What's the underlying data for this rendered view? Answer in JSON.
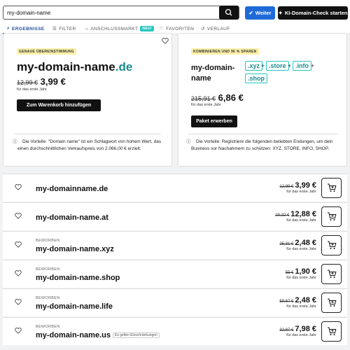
{
  "search": {
    "value": "my-domain-name"
  },
  "buttons": {
    "weiter": "Weiter",
    "ki": "KI-Domain-Check starten"
  },
  "tabs": [
    {
      "label": "ERGEBNISSE"
    },
    {
      "label": "FILTER"
    },
    {
      "label": "ANSCHLUSSMARKT"
    },
    {
      "label": "FAVORITEN"
    },
    {
      "label": "VERLAUF"
    }
  ],
  "tab_badge": "NEU!",
  "card_exact": {
    "badge": "GENAUE ÜBEREINSTIMMUNG",
    "domain_name": "my-domain-name",
    "domain_tld": ".de",
    "old_price": "12,99 €",
    "price": "3,99 €",
    "period": "für das erste Jahr",
    "cta": "Zum Warenkorb hinzufügen",
    "info": "Die Vorteile: \"Domain name\" ist ein Schlagwort von hohem Wert, das einen durchschnittlichen Verkaufspreis von 2.066,00 € erzielt."
  },
  "card_bundle": {
    "badge": "KOMBINIEREN UND 96 % SPAREN",
    "name_line1": "my-domain-",
    "name_line2": "name",
    "tlds": [
      ".xyz",
      ".store",
      ".info",
      ".shop"
    ],
    "old_price": "215,91 €",
    "price": "6,86 €",
    "period": "für das erste Jahr",
    "cta": "Paket erwerben",
    "info": "Die Vorteile: Registriere die folgenden beliebten Endungen, um dein Business vor Nachahmern zu schützen: XYZ, STORE, INFO, SHOP."
  },
  "results": [
    {
      "label": "",
      "domain": "my-domainname.de",
      "old": "12,99 €",
      "price": "3,99 €",
      "period": "für das erste Jahr",
      "hint": ""
    },
    {
      "label": "",
      "domain": "my-domain-name.at",
      "old": "20,22 €",
      "price": "12,88 €",
      "period": "für das erste Jahr",
      "hint": ""
    },
    {
      "label": "BEWORBEN",
      "domain": "my-domain-name.xyz",
      "old": "25,31 €",
      "price": "2,48 €",
      "period": "für das erste Jahr",
      "hint": ""
    },
    {
      "label": "BEWORBEN",
      "domain": "my-domain-name.shop",
      "old": "55 €",
      "price": "1,90 €",
      "period": "für das erste Jahr",
      "hint": ""
    },
    {
      "label": "BEWORBEN",
      "domain": "my-domain-name.life",
      "old": "59,67 €",
      "price": "2,48 €",
      "period": "für das erste Jahr",
      "hint": ""
    },
    {
      "label": "BEWORBEN",
      "domain": "my-domain-name.us",
      "old": "32,87 €",
      "price": "7,98 €",
      "period": "für das erste Jahr",
      "hint": "Es gelten Einschränkungen"
    }
  ]
}
